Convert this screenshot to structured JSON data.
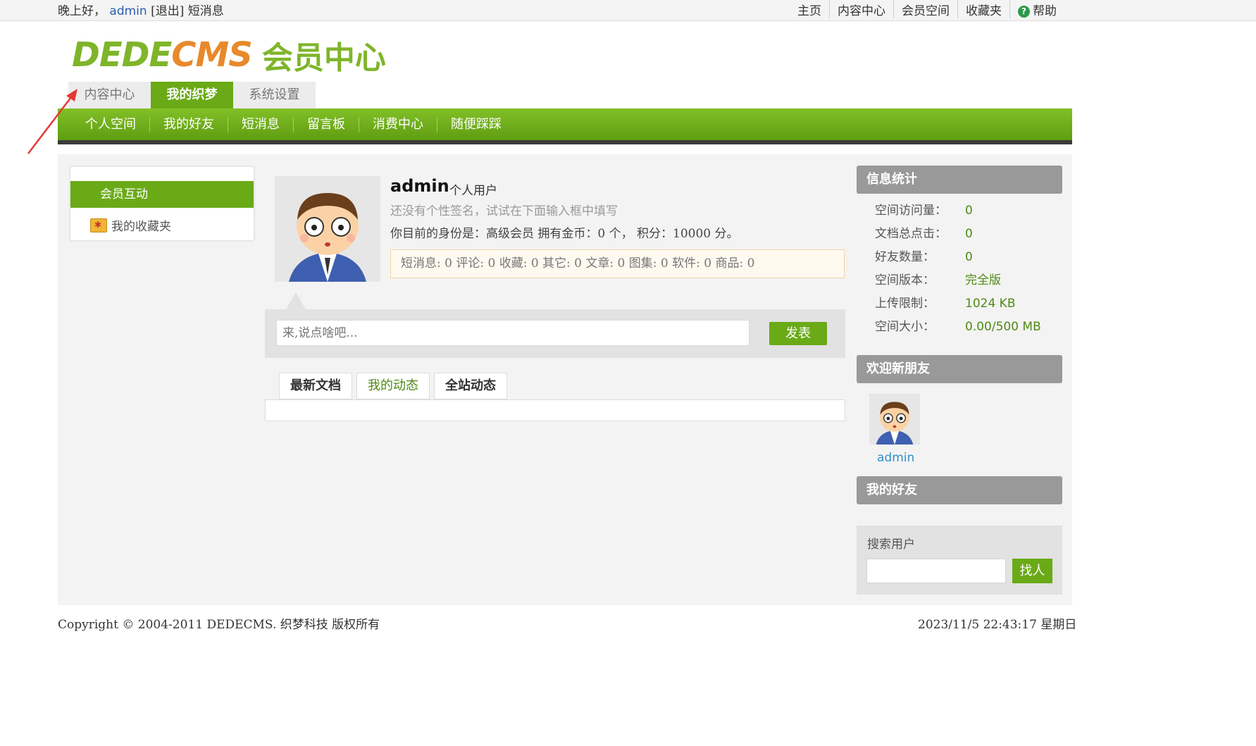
{
  "topbar": {
    "greeting": "晚上好，",
    "username": "admin",
    "logout": "[退出]",
    "messages": "短消息",
    "links": [
      "主页",
      "内容中心",
      "会员空间",
      "收藏夹",
      "帮助"
    ]
  },
  "logo": {
    "part1": "DEDE",
    "part2": "CMS",
    "part3": "会员中心"
  },
  "main_tabs": [
    "内容中心",
    "我的织梦",
    "系统设置"
  ],
  "main_tabs_active": "我的织梦",
  "subnav": [
    "个人空间",
    "我的好友",
    "短消息",
    "留言板",
    "消费中心",
    "随便踩踩"
  ],
  "left": {
    "section": "会员互动",
    "favorites": "我的收藏夹"
  },
  "profile": {
    "name": "admin",
    "type": "个人用户",
    "signature": "还没有个性签名，试试在下面输入框中填写",
    "identity": "你目前的身份是：高级会员 拥有金币：0 个， 积分：10000 分。",
    "stats": "短消息: 0 评论: 0 收藏: 0 其它: 0 文章: 0 图集: 0 软件: 0 商品: 0"
  },
  "post": {
    "placeholder": "来,说点啥吧...",
    "button": "发表"
  },
  "feed_tabs": [
    "最新文档",
    "我的动态",
    "全站动态"
  ],
  "feed_tabs_active": "我的动态",
  "right": {
    "stats_title": "信息统计",
    "stats": [
      {
        "label": "空间访问量：",
        "value": "0"
      },
      {
        "label": "文档总点击：",
        "value": "0"
      },
      {
        "label": "好友数量：",
        "value": "0"
      },
      {
        "label": "空间版本：",
        "value": "完全版"
      },
      {
        "label": "上传限制：",
        "value": "1024 KB"
      },
      {
        "label": "空间大小：",
        "value": "0.00/500 MB"
      }
    ],
    "new_friends_title": "欢迎新朋友",
    "new_friend": "admin",
    "my_friends_title": "我的好友",
    "search_label": "搜索用户",
    "search_button": "找人"
  },
  "footer": {
    "copyright": "Copyright © 2004-2011 DEDECMS. 织梦科技 版权所有",
    "datetime": "2023/11/5 22:43:17 星期日"
  },
  "colors": {
    "accent": "#6aaa17",
    "orange": "#e8892b",
    "annotation": "#e53935"
  }
}
